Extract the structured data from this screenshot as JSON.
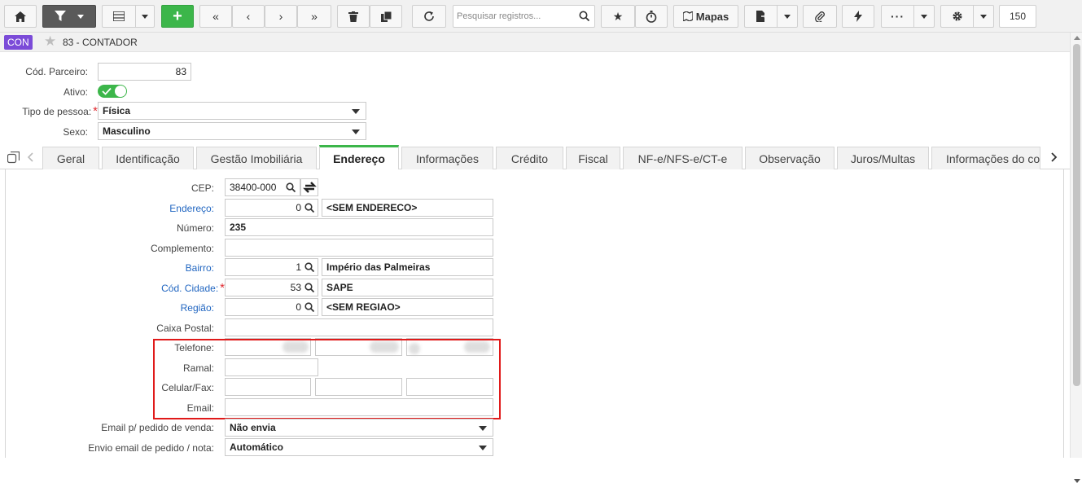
{
  "toolbar": {
    "search_placeholder": "Pesquisar registros...",
    "maps_label": "Mapas",
    "record_count": "150"
  },
  "title": {
    "badge": "CON",
    "name": "83 - CONTADOR"
  },
  "header": {
    "cod_parceiro": {
      "label": "Cód. Parceiro:",
      "value": "83"
    },
    "ativo": {
      "label": "Ativo:",
      "value": "on"
    },
    "tipo_pessoa": {
      "label": "Tipo de pessoa:",
      "value": "Física"
    },
    "sexo": {
      "label": "Sexo:",
      "value": "Masculino"
    }
  },
  "tabs": [
    {
      "label": "Geral"
    },
    {
      "label": "Identificação"
    },
    {
      "label": "Gestão Imobiliária"
    },
    {
      "label": "Endereço"
    },
    {
      "label": "Informações"
    },
    {
      "label": "Crédito"
    },
    {
      "label": "Fiscal"
    },
    {
      "label": "NF-e/NFS-e/CT-e"
    },
    {
      "label": "Observação"
    },
    {
      "label": "Juros/Multas"
    },
    {
      "label": "Informações do co"
    }
  ],
  "active_tab": "Endereço",
  "address": {
    "cep": {
      "label": "CEP:",
      "value": "38400-000"
    },
    "endereco": {
      "label": "Endereço:",
      "code": "0",
      "desc": "<SEM ENDERECO>"
    },
    "numero": {
      "label": "Número:",
      "value": "235"
    },
    "complemento": {
      "label": "Complemento:",
      "value": ""
    },
    "bairro": {
      "label": "Bairro:",
      "code": "1",
      "desc": "Império das Palmeiras"
    },
    "cidade": {
      "label": "Cód. Cidade:",
      "code": "53",
      "desc": "SAPE"
    },
    "regiao": {
      "label": "Região:",
      "code": "0",
      "desc": "<SEM REGIAO>"
    },
    "caixa_postal": {
      "label": "Caixa Postal:",
      "value": ""
    },
    "telefone": {
      "label": "Telefone:"
    },
    "ramal": {
      "label": "Ramal:",
      "value": ""
    },
    "celular": {
      "label": "Celular/Fax:"
    },
    "email": {
      "label": "Email:",
      "value": ""
    },
    "email_pedido": {
      "label": "Email p/ pedido de venda:",
      "value": "Não envia"
    },
    "envio_email": {
      "label": "Envio email de pedido / nota:",
      "value": "Automático"
    }
  },
  "colors": {
    "accent_green": "#3cb64a",
    "badge_purple": "#7b4bd8",
    "link_blue": "#2166c1",
    "highlight_red": "#e01a1a",
    "required_red": "#e0292f"
  }
}
